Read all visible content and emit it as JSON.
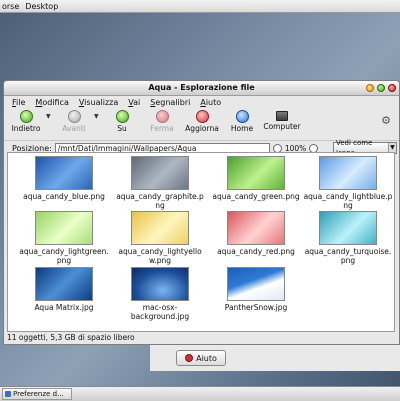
{
  "desktop_menu": {
    "items": [
      "orse",
      "Desktop"
    ]
  },
  "window": {
    "title": "Aqua - Esplorazione file",
    "menu": [
      "File",
      "Modifica",
      "Visualizza",
      "Vai",
      "Segnalibri",
      "Aiuto"
    ],
    "toolbar": {
      "back": "Indietro",
      "forward": "Avanti",
      "up": "Su",
      "stop": "Ferma",
      "reload": "Aggiorna",
      "home": "Home",
      "computer": "Computer"
    },
    "location": {
      "label": "Posizione:",
      "path": "/mnt/Dati/Immagini/Wallpapers/Aqua",
      "zoom": "100%",
      "view_mode": "Vedi come Icone"
    },
    "files": [
      {
        "name": "aqua_candy_blue.png",
        "thumb": "blue"
      },
      {
        "name": "aqua_candy_graphite.p ng",
        "thumb": "graphite"
      },
      {
        "name": "aqua_candy_green.png",
        "thumb": "green"
      },
      {
        "name": "aqua_candy_lightblue.p ng",
        "thumb": "lightblue"
      },
      {
        "name": "aqua_candy_lightgreen. png",
        "thumb": "lightgreen"
      },
      {
        "name": "aqua_candy_lightyello w.png",
        "thumb": "lightyellow"
      },
      {
        "name": "aqua_candy_red.png",
        "thumb": "red"
      },
      {
        "name": "aqua_candy_turquoise. png",
        "thumb": "turquoise"
      },
      {
        "name": "Aqua Matrix.jpg",
        "thumb": "matrix"
      },
      {
        "name": "mac-osx- background.jpg",
        "thumb": "macosx"
      },
      {
        "name": "PantherSnow.jpg",
        "thumb": "panther"
      }
    ],
    "status": "11 oggetti, 5,3 GB di spazio libero"
  },
  "help_button": {
    "label": "Aiuto"
  },
  "taskbar": {
    "item": "Preferenze d..."
  }
}
